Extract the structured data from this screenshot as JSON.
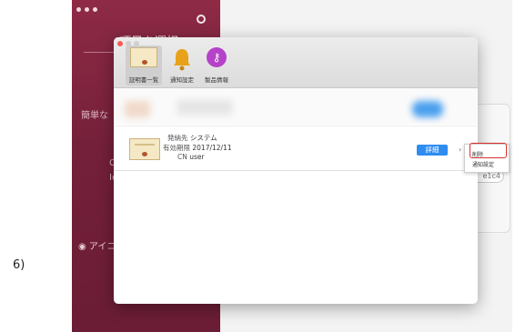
{
  "step_label": "6)",
  "background_window": {
    "title": "項目を選択",
    "side_text_1": "簡単な",
    "side_text_2": "C",
    "side_text_3": "Ic",
    "radio_label": "◉ アイコ",
    "chip_text": "e1c4"
  },
  "dialog": {
    "toolbar": {
      "items": [
        {
          "label": "証明書一覧",
          "icon": "certificate-icon"
        },
        {
          "label": "通知設定",
          "icon": "bell-icon"
        },
        {
          "label": "製品情報",
          "icon": "key-icon"
        }
      ]
    },
    "certificate": {
      "issuer_label": "発納先",
      "issuer_value": "システム",
      "expiry_label": "有効期限",
      "expiry_value": "2017/12/11",
      "cn_label": "CN",
      "cn_value": "user",
      "detail_button": "詳細"
    }
  },
  "context_menu": {
    "items": [
      "削除",
      "通知設定"
    ]
  },
  "colors": {
    "sidebar": "#74203a",
    "accent_button": "#2f8cf0",
    "highlight": "#d9302f"
  }
}
